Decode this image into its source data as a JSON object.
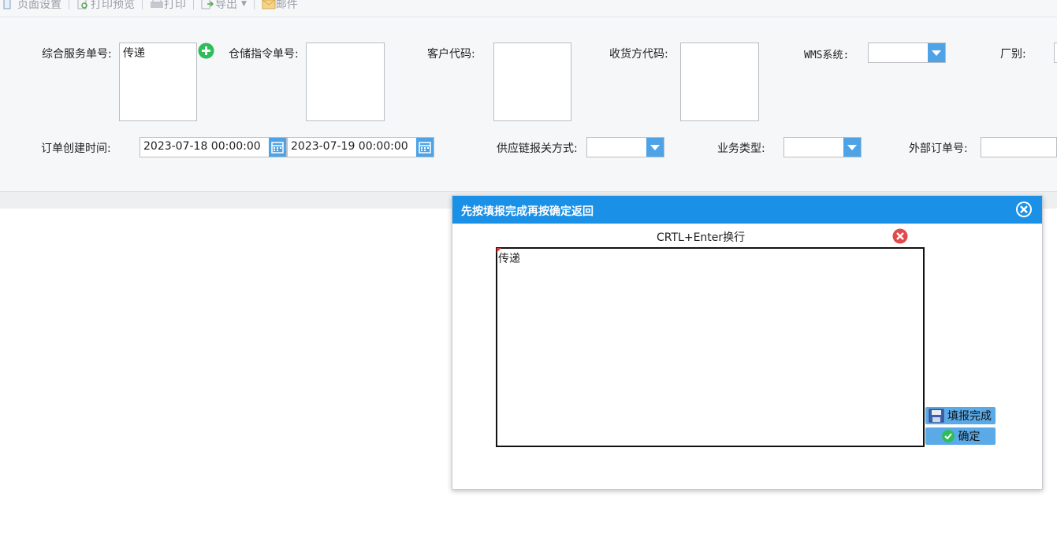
{
  "toolbar": {
    "items": [
      {
        "label": "页面设置",
        "icon": "page-setup-icon"
      },
      {
        "label": "打印预览",
        "icon": "print-preview-icon"
      },
      {
        "label": "打印",
        "icon": "printer-icon"
      },
      {
        "label": "导出",
        "icon": "export-icon"
      },
      {
        "label": "邮件",
        "icon": "mail-icon"
      }
    ]
  },
  "filters": {
    "service_order_label": "综合服务单号:",
    "service_order_value": "传递",
    "warehouse_instruction_label": "仓储指令单号:",
    "customer_code_label": "客户代码:",
    "consignee_code_label": "收货方代码:",
    "wms_label": "WMS系统:",
    "factory_label": "厂别:",
    "order_created_label": "订单创建时间:",
    "date_from": "2023-07-18 00:00:00",
    "date_to": "2023-07-19 00:00:00",
    "supply_chain_label": "供应链报关方式:",
    "business_type_label": "业务类型:",
    "external_order_label": "外部订单号:"
  },
  "dialog": {
    "title": "先按填报完成再按确定返回",
    "hint": "CRTL+Enter换行",
    "content": "传递",
    "fill_done_label": "填报完成",
    "confirm_label": "确定"
  },
  "colors": {
    "accent": "#1a90e6",
    "combo_button": "#4ea3e6",
    "add_green": "#2ebd59",
    "clear_red": "#e04b4b"
  }
}
